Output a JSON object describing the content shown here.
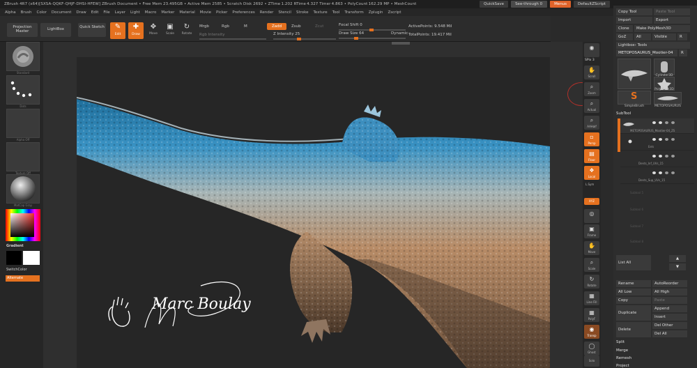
{
  "titlebar": {
    "title": "ZBrush 4R7 (x64)[SXSA-QQKF-QHJF-DHSI-HFEW]    ZBrush Document    • Free Mem 23.495GB • Active Mem 2585 • Scratch Disk 2692 • ZTime 1.202 RTime 4.327 Timer 4.863 • PolyCount 162.29 MP • MeshCount",
    "quicksave": "QuickSave",
    "see_through": "See-through 0",
    "menus": "Menus",
    "default_script": "DefaultZScript"
  },
  "menubar": [
    "Alpha",
    "Brush",
    "Color",
    "Document",
    "Draw",
    "Edit",
    "File",
    "Layer",
    "Light",
    "Macro",
    "Marker",
    "Material",
    "Movie",
    "Picker",
    "Preferences",
    "Render",
    "Stencil",
    "Stroke",
    "Texture",
    "Tool",
    "Transform",
    "Zplugin",
    "Zscript"
  ],
  "toolbar": {
    "projection_master": "Projection Master",
    "lightbox": "LightBox",
    "quick_sketch": "Quick Sketch",
    "edit": "Edit",
    "draw": "Draw",
    "move": "Move",
    "scale": "Scale",
    "rotate": "Rotate",
    "mrgb": "Mrgb",
    "rgb": "Rgb",
    "m": "M",
    "rgb_intensity": "Rgb Intensity",
    "zadd": "Zadd",
    "zsub": "Zsub",
    "zcut": "Zcut",
    "z_intensity": "Z Intensity 25",
    "focal_shift": "Focal Shift 0",
    "draw_size": "Draw Size 64",
    "dynamic": "Dynamic",
    "active_points": "ActivePoints: 9.548 Mil",
    "total_points": "TotalPoints: 19.417 Mil"
  },
  "leftshelf": {
    "brush_cap": "Standard",
    "stroke_cap": "Dots",
    "alpha_cap": "Alpha Off",
    "texture_cap": "Texture Off",
    "material_cap": "MatCap Gray",
    "gradient": "Gradient",
    "switch_color": "SwitchColor",
    "alternate": "Alternate"
  },
  "rightshelf": [
    {
      "name": "bpr",
      "label": "BPR"
    },
    {
      "name": "spix",
      "label": "SPix 3"
    },
    {
      "name": "scroll",
      "label": "Scroll"
    },
    {
      "name": "zoom",
      "label": "Zoom"
    },
    {
      "name": "actual",
      "label": "Actual"
    },
    {
      "name": "aahalf",
      "label": "AAHalf"
    },
    {
      "name": "persp",
      "label": "Persp"
    },
    {
      "name": "floor",
      "label": "Floor"
    },
    {
      "name": "local",
      "label": "Local"
    },
    {
      "name": "lsym",
      "label": "L.Sym"
    },
    {
      "name": "xyz",
      "label": "XYZ"
    },
    {
      "name": "frame",
      "label": "Frame"
    },
    {
      "name": "move",
      "label": "Move"
    },
    {
      "name": "scale",
      "label": "Scale"
    },
    {
      "name": "rotate",
      "label": "Rotate"
    },
    {
      "name": "linefill",
      "label": "Line Fill"
    },
    {
      "name": "polyf",
      "label": "PolyF"
    },
    {
      "name": "transp",
      "label": "Transp"
    },
    {
      "name": "ghost",
      "label": "Ghost"
    },
    {
      "name": "solo",
      "label": "Solo"
    },
    {
      "name": "xpose",
      "label": "Xpose"
    }
  ],
  "tool_panel": {
    "copy_tool": "Copy Tool",
    "paste_tool": "Paste Tool",
    "import": "Import",
    "export": "Export",
    "clone": "Clone",
    "make_polymesh": "Make PolyMesh3D",
    "goz": "GoZ",
    "all": "All",
    "visible": "Visible",
    "r": "R",
    "lightbox_tools": "Lightbox› Tools",
    "current_tool": "METOPOSAURUS_Mootier-04",
    "tool_items": [
      "METOPOSAURUS_Mootier-04",
      "Cylinder3D",
      "PolyMesh3D",
      "SimpleBrush",
      "METOPOSAURUS"
    ],
    "subtool": "SubTool",
    "subtools": [
      "METOPOSAURUS_Mootier-04_ZS",
      "Eels",
      "Dents_Inf_UVs_15",
      "Dents_Sup_UVs_15"
    ],
    "empty_slots": [
      "Subtool 5",
      "Subtool 6",
      "Subtool 7",
      "Subtool 8"
    ],
    "list_all": "List All",
    "rename": "Rename",
    "auto_reorder": "AutoReorder",
    "all_low": "All Low",
    "all_high": "All High",
    "copy": "Copy",
    "paste": "Paste",
    "duplicate": "Duplicate",
    "append": "Append",
    "insert": "Insert",
    "delete": "Delete",
    "del_other": "Del Other",
    "del_all": "Del All",
    "split": "Split",
    "merge": "Merge",
    "remesh": "Remesh",
    "project": "Project"
  },
  "signature": {
    "text": "Marc Boulay"
  },
  "colors": {
    "accent": "#e5711f",
    "skin_blue": "#2f86b8",
    "skin_tan": "#b38a66"
  }
}
